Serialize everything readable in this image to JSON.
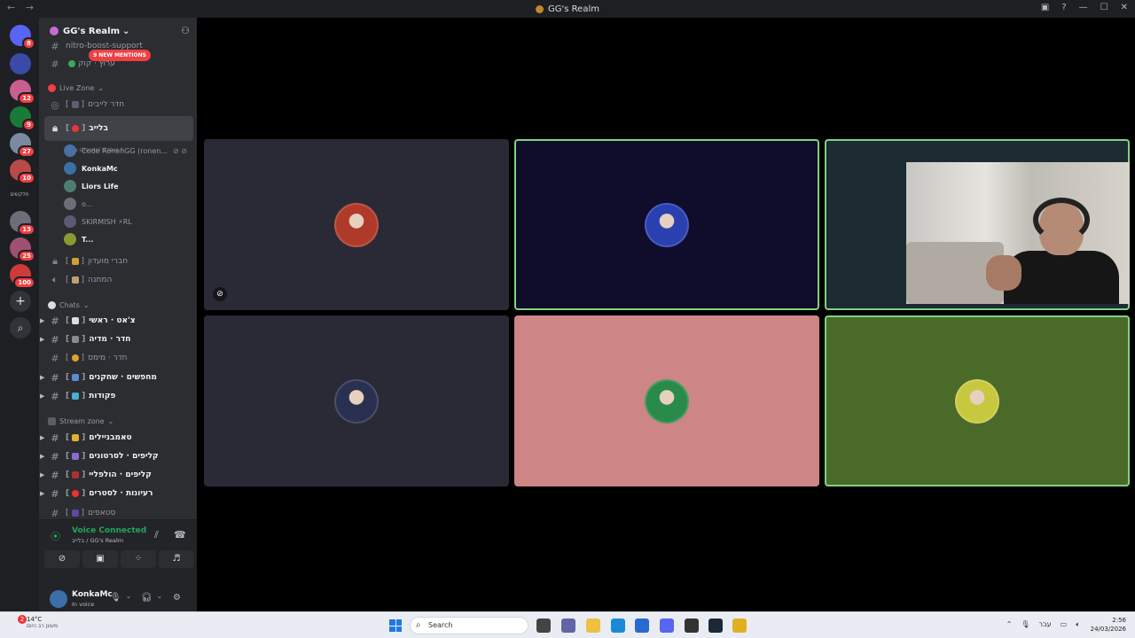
{
  "titlebar": {
    "back": "←",
    "forward": "→",
    "title": "GG's Realm",
    "inbox_icon": "inbox-icon",
    "help": "?",
    "minimize": "—",
    "maximize": "☐",
    "close": "✕"
  },
  "guilds": [
    {
      "name": "dm-home",
      "color": "#5865f2",
      "badge": "8"
    },
    {
      "name": "server-1",
      "color": "#3a4aa8",
      "badge": ""
    },
    {
      "name": "server-2",
      "color": "#c95f8f",
      "badge": "12"
    },
    {
      "name": "server-gg",
      "color": "#1a7a3a",
      "badge": "9"
    },
    {
      "name": "server-4",
      "color": "#7a8aa0",
      "badge": "27"
    },
    {
      "name": "server-5",
      "color": "#b84a4a",
      "badge": "10"
    },
    {
      "name": "server-7",
      "color": "#6a6e78",
      "badge": "13"
    },
    {
      "name": "server-8",
      "color": "#a05070",
      "badge": "25"
    },
    {
      "name": "server-svb",
      "color": "#d03a3a",
      "badge": "100"
    }
  ],
  "guild_folder_label": "חלקשים",
  "guild_add": "+",
  "guild_discover": "⌕",
  "server": {
    "name": "GG's Realm",
    "chevron": "⌄"
  },
  "mentions_pill": "9 NEW MENTIONS",
  "channels_top": [
    {
      "name": "nitro-boost-support",
      "faded": true
    },
    {
      "name": "ערוץ · קוק",
      "faded": true
    }
  ],
  "live_zone": {
    "label": "Live Zone",
    "channels": [
      {
        "name": "חדר לייבים",
        "bracket": "[ ]",
        "icon": "voice"
      },
      {
        "name": "בלייב",
        "bracket": "[ ]",
        "icon": "lock",
        "active": true
      }
    ],
    "status": "Set a channel status",
    "voice_users": [
      {
        "name": "Code RonenGG (ronen...",
        "color": "#4a6fa5",
        "bold": false,
        "muted": true
      },
      {
        "name": "KonkaMc",
        "color": "#3b6fa8",
        "bold": true
      },
      {
        "name": "Liors Life",
        "color": "#4e7d6e",
        "bold": true
      },
      {
        "name": "o...",
        "color": "#6a6e78",
        "bold": false
      },
      {
        "name": "SKIRMISH ⚡RL",
        "color": "#5a5a70",
        "bold": false
      },
      {
        "name": "T...",
        "color": "#8a9a30",
        "bold": true
      }
    ],
    "more": [
      {
        "name": "חברי מועדון",
        "bracket": "[ ]",
        "icon": "lock"
      },
      {
        "name": "המתנה",
        "bracket": "[ ]",
        "icon": "speaker"
      }
    ]
  },
  "chats": {
    "label": "Chats",
    "channels": [
      {
        "name": "צ'אט · ראשי",
        "bright": true,
        "caret": true
      },
      {
        "name": "חדר · מדיה",
        "bright": true,
        "caret": true
      },
      {
        "name": "חדר · מימס",
        "bright": false,
        "caret": false
      },
      {
        "name": "מחפשים · שחקנים",
        "bright": true,
        "caret": true
      },
      {
        "name": "פקודות",
        "bright": true,
        "caret": true
      }
    ]
  },
  "stream_zone": {
    "label": "Stream zone",
    "channels": [
      {
        "name": "טאמבניילים",
        "bright": true,
        "caret": true
      },
      {
        "name": "קליפים · לסרטונים",
        "bright": true,
        "caret": true
      },
      {
        "name": "קליפים · הולפליי",
        "bright": true,
        "caret": true
      },
      {
        "name": "רעיונות · לסטרים",
        "bright": true,
        "caret": true
      },
      {
        "name": "סטאפים",
        "bright": false,
        "caret": false
      }
    ]
  },
  "voice_panel": {
    "title": "Voice Connected",
    "subtitle": "בלייב / GG's Realm",
    "noise_icon": "noise-suppression-icon",
    "disconnect_icon": "hangup-icon",
    "buttons": [
      "camera-off-icon",
      "screen-share-icon",
      "activities-icon",
      "soundboard-icon"
    ]
  },
  "user_panel": {
    "name": "KonkaMc",
    "status": "In voice"
  },
  "stage": {
    "tiles": [
      {
        "name": "tile-user-1",
        "bg": "#2a2a36",
        "avatar": "#b03a2a",
        "speaking": false,
        "muted": true
      },
      {
        "name": "tile-user-2",
        "bg": "#0f0c2c",
        "avatar": "#2a40b0",
        "speaking": true,
        "muted": false
      },
      {
        "name": "tile-camera",
        "bg": "#1c2c32",
        "avatar": "",
        "speaking": true,
        "muted": false,
        "camera": true
      },
      {
        "name": "tile-user-4",
        "bg": "#2a2a36",
        "avatar": "#2a3050",
        "speaking": false,
        "muted": false
      },
      {
        "name": "tile-user-5",
        "bg": "#cd8585",
        "avatar": "#2a8a4a",
        "speaking": false,
        "muted": false
      },
      {
        "name": "tile-user-6",
        "bg": "#4a6a2a",
        "avatar": "#c8c840",
        "speaking": true,
        "muted": false
      }
    ]
  },
  "taskbar": {
    "weather_temp": "14°C",
    "weather_desc": "מעונן רב היום",
    "weather_badge": "2",
    "search_placeholder": "Search",
    "lang": "עבר",
    "time": "2:56",
    "date": "24/03/2026",
    "apps": [
      {
        "name": "task-view-icon",
        "color": "#444"
      },
      {
        "name": "teams-icon",
        "color": "#6264a7"
      },
      {
        "name": "file-explorer-icon",
        "color": "#f0c040"
      },
      {
        "name": "edge-icon",
        "color": "#1a8ad8"
      },
      {
        "name": "store-icon",
        "color": "#2a6ad0"
      },
      {
        "name": "discord-icon",
        "color": "#5865f2"
      },
      {
        "name": "app-icon",
        "color": "#333"
      },
      {
        "name": "steam-icon",
        "color": "#1b2838"
      },
      {
        "name": "chrome-icon",
        "color": "#e0b020"
      }
    ]
  }
}
